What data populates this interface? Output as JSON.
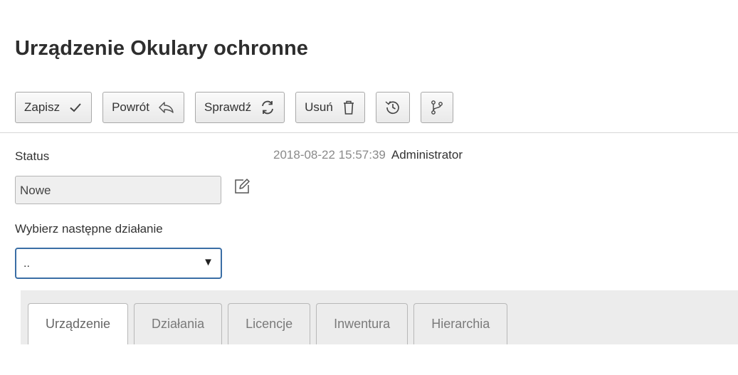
{
  "page": {
    "title": "Urządzenie Okulary ochronne"
  },
  "toolbar": {
    "buttons": [
      {
        "label": "Zapisz",
        "icon": "check-icon"
      },
      {
        "label": "Powrót",
        "icon": "undo-arrow-icon"
      },
      {
        "label": "Sprawdź",
        "icon": "refresh-icon"
      },
      {
        "label": "Usuń",
        "icon": "trash-icon"
      },
      {
        "label": "",
        "icon": "history-icon"
      },
      {
        "label": "",
        "icon": "branch-icon"
      }
    ]
  },
  "status": {
    "label": "Status",
    "value": "Nowe",
    "timestamp": "2018-08-22 15:57:39",
    "user": "Administrator"
  },
  "next_action": {
    "label": "Wybierz następne działanie",
    "selected": ".."
  },
  "tabs": [
    {
      "label": "Urządzenie",
      "active": true
    },
    {
      "label": "Działania",
      "active": false
    },
    {
      "label": "Licencje",
      "active": false
    },
    {
      "label": "Inwentura",
      "active": false
    },
    {
      "label": "Hierarchia",
      "active": false
    }
  ]
}
